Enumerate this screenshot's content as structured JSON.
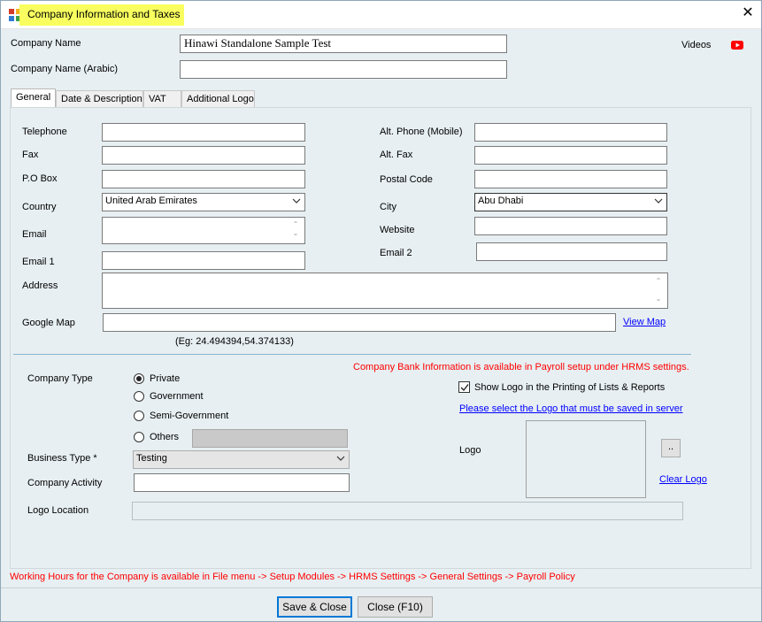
{
  "window": {
    "title": "Company Information and Taxes",
    "close_glyph": "✕"
  },
  "header": {
    "company_name_label": "Company Name",
    "company_name_value": "Hinawi Standalone Sample Test",
    "company_name_arabic_label": "Company Name (Arabic)",
    "company_name_arabic_value": "",
    "videos_label": "Videos"
  },
  "tabs": [
    {
      "label": "General",
      "active": true
    },
    {
      "label": "Date & Description",
      "active": false
    },
    {
      "label": "VAT",
      "active": false
    },
    {
      "label": "Additional Logo",
      "active": false
    }
  ],
  "general": {
    "telephone_label": "Telephone",
    "telephone_value": "",
    "fax_label": "Fax",
    "fax_value": "",
    "pobox_label": "P.O Box",
    "pobox_value": "",
    "country_label": "Country",
    "country_value": "United Arab Emirates",
    "email_label": "Email",
    "email_value": "",
    "email1_label": "Email 1",
    "email1_value": "",
    "alt_phone_label": "Alt. Phone (Mobile)",
    "alt_phone_value": "",
    "alt_fax_label": "Alt. Fax",
    "alt_fax_value": "",
    "postal_code_label": "Postal Code",
    "postal_code_value": "",
    "city_label": "City",
    "city_value": "Abu Dhabi",
    "website_label": "Website",
    "website_value": "",
    "email2_label": "Email 2",
    "email2_value": "",
    "address_label": "Address",
    "address_value": "",
    "google_map_label": "Google Map",
    "google_map_value": "",
    "view_map_link": "View Map",
    "google_map_hint": "(Eg: 24.494394,54.374133)"
  },
  "company": {
    "type_label": "Company Type",
    "type_options": [
      "Private",
      "Government",
      "Semi-Government",
      "Others"
    ],
    "type_selected": "Private",
    "business_type_label": "Business Type *",
    "business_type_value": "Testing",
    "activity_label": "Company Activity",
    "activity_value": "",
    "logo_location_label": "Logo Location",
    "logo_location_value": "",
    "bank_info_notice": "Company Bank Information is available in Payroll setup under HRMS settings.",
    "show_logo_label": "Show Logo in the Printing of Lists & Reports",
    "show_logo_checked": true,
    "select_logo_link": "Please select the Logo that must be saved in server",
    "logo_label": "Logo",
    "browse_button": "..",
    "clear_logo_link": "Clear Logo"
  },
  "footer": {
    "working_hours_notice": "Working Hours for the Company is available in File menu -> Setup Modules -> HRMS Settings -> General Settings -> Payroll Policy",
    "save_close_button": "Save & Close",
    "close_button": "Close (F10)"
  },
  "colors": {
    "title_highlight": "#f8ff5e",
    "panel_background": "#e7eff2",
    "notice_red": "#ff0000",
    "link_blue": "#0000ff",
    "youtube_red": "#ff0000"
  },
  "icons": [
    "app-icon",
    "close-icon",
    "youtube-icon",
    "chevron-down-icon",
    "checkmark-icon"
  ]
}
